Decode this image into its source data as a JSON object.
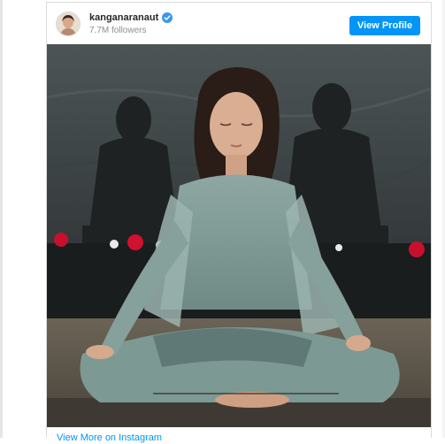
{
  "post": {
    "username": "kanganaranaut",
    "followers": "7.7M followers",
    "view_profile_label": "View Profile",
    "footer_link": "View More on Instagram"
  },
  "icons": {
    "verified": "verified-badge-icon",
    "avatar": "profile-avatar"
  },
  "colors": {
    "accent": "#0095f6",
    "verified": "#3897f0",
    "username": "#262626",
    "muted": "#8e8e8e"
  }
}
